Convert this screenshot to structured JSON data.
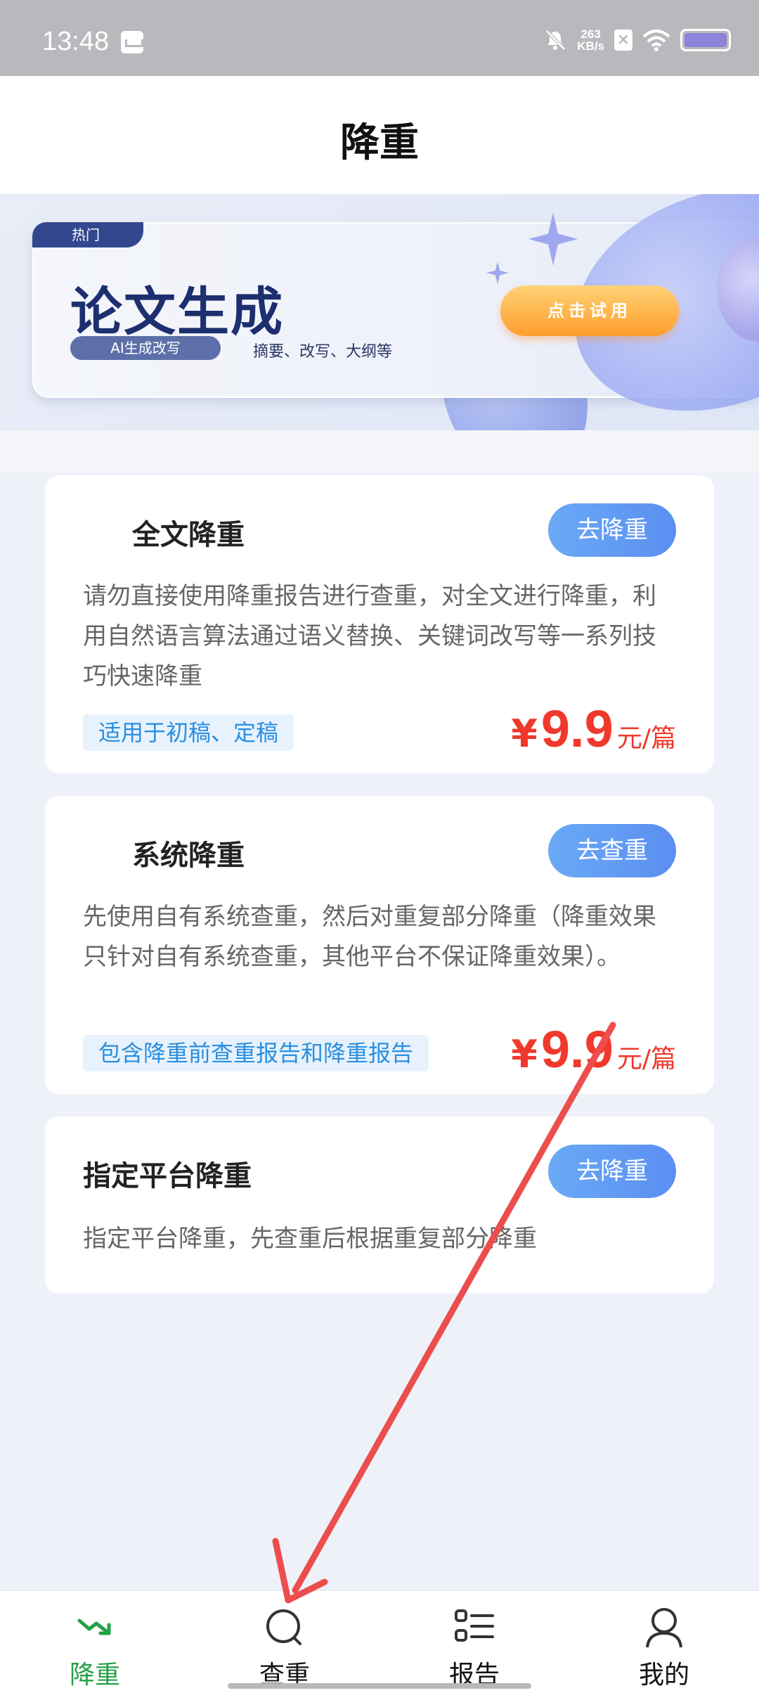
{
  "status_bar": {
    "time": "13:48",
    "net_speed_value": "263",
    "net_speed_unit": "KB/s"
  },
  "header": {
    "title": "降重"
  },
  "banner": {
    "hot_label": "热门",
    "title": "论文生成",
    "tag": "AI生成改写",
    "subtitle": "摘要、改写、大纲等",
    "cta": "点击试用"
  },
  "cards": [
    {
      "title": "全文降重",
      "button": "去降重",
      "description": "请勿直接使用降重报告进行查重，对全文进行降重，利用自然语言算法通过语义替换、关键词改写等一系列技巧快速降重",
      "tag": "适用于初稿、定稿",
      "price_currency": "¥",
      "price_value": "9.9",
      "price_unit": "元/篇"
    },
    {
      "title": "系统降重",
      "button": "去查重",
      "description": "先使用自有系统查重，然后对重复部分降重（降重效果只针对自有系统查重，其他平台不保证降重效果）。",
      "tag": "包含降重前查重报告和降重报告",
      "price_currency": "¥",
      "price_value": "9.9",
      "price_unit": "元/篇"
    },
    {
      "title": "指定平台降重",
      "button": "去降重",
      "description": "指定平台降重，先查重后根据重复部分降重"
    }
  ],
  "bottom_nav": [
    {
      "label": "降重",
      "icon": "trend-down-icon",
      "active": true
    },
    {
      "label": "查重",
      "icon": "search-icon",
      "active": false
    },
    {
      "label": "报告",
      "icon": "list-icon",
      "active": false
    },
    {
      "label": "我的",
      "icon": "user-icon",
      "active": false
    }
  ],
  "colors": {
    "accent_green": "#24a046",
    "button_blue": "#5b8ef1",
    "price_red": "#f0392c",
    "tag_text_blue": "#2a8fe0",
    "annotation_arrow": "#ec4d4d"
  }
}
